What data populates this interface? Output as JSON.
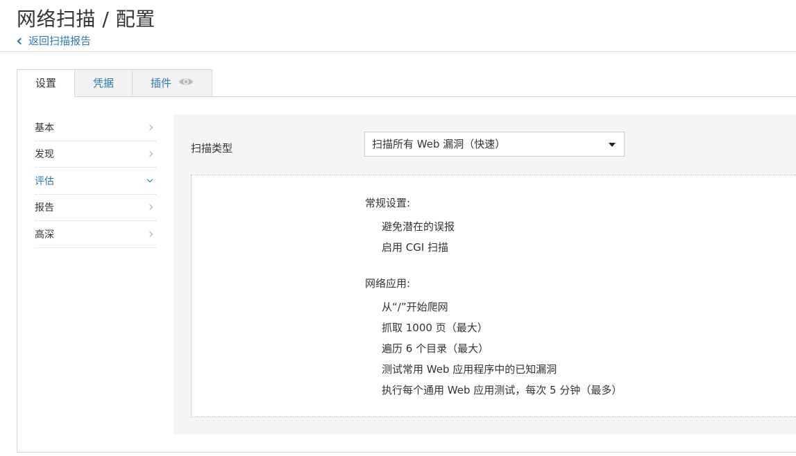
{
  "header": {
    "title": "网络扫描 / 配置",
    "back_label": "返回扫描报告"
  },
  "tabs": [
    {
      "label": "设置",
      "active": true
    },
    {
      "label": "凭据",
      "active": false
    },
    {
      "label": "插件",
      "active": false,
      "icon": "eye-icon"
    }
  ],
  "sidebar": {
    "items": [
      {
        "label": "基本",
        "active": false
      },
      {
        "label": "发现",
        "active": false
      },
      {
        "label": "评估",
        "active": true
      },
      {
        "label": "报告",
        "active": false
      },
      {
        "label": "高深",
        "active": false
      }
    ]
  },
  "main": {
    "scan_type_label": "扫描类型",
    "scan_type_value": "扫描所有 Web 漏洞（快速）",
    "groups": [
      {
        "title": "常规设置:",
        "items": [
          "避免潜在的误报",
          "启用 CGI 扫描"
        ]
      },
      {
        "title": "网络应用:",
        "items": [
          "从“/”开始爬网",
          "抓取 1000 页（最大）",
          "遍历 6 个目录（最大）",
          "测试常用 Web 应用程序中的已知漏洞",
          "执行每个通用 Web 应用测试，每次 5 分钟（最多）"
        ]
      }
    ]
  },
  "colors": {
    "link": "#2a7ab0",
    "panel_bg": "#f5f5f5"
  }
}
